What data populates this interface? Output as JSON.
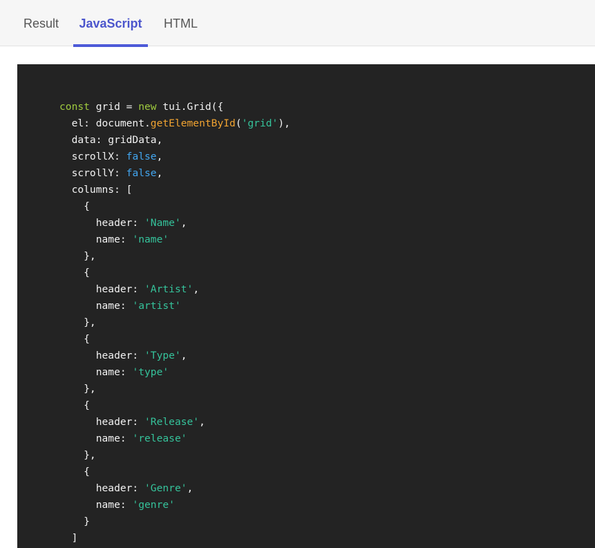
{
  "tabs": [
    {
      "label": "Result",
      "active": false
    },
    {
      "label": "JavaScript",
      "active": true
    },
    {
      "label": "HTML",
      "active": false
    }
  ],
  "colors": {
    "accent": "#4d5ad8",
    "code_background": "#232323",
    "keyword": "#9fca3e",
    "function": "#f0a331",
    "string": "#35c39b",
    "boolean": "#42a6f0"
  },
  "code": {
    "line1": {
      "kw_const": "const",
      "t1": " grid = ",
      "kw_new": "new",
      "t2": " tui.Grid({"
    },
    "line2": {
      "t1": "  el: document.",
      "fn": "getElementById",
      "t2": "(",
      "str": "'grid'",
      "t3": "),"
    },
    "line3": {
      "t1": "  data: gridData,"
    },
    "line4": {
      "t1": "  scrollX: ",
      "bool": "false",
      "t2": ","
    },
    "line5": {
      "t1": "  scrollY: ",
      "bool": "false",
      "t2": ","
    },
    "line6": {
      "t1": "  columns: ["
    },
    "line7": {
      "t1": "    {"
    },
    "line8": {
      "t1": "      header: ",
      "str": "'Name'",
      "t2": ","
    },
    "line9": {
      "t1": "      name: ",
      "str": "'name'"
    },
    "line10": {
      "t1": "    },"
    },
    "line11": {
      "t1": "    {"
    },
    "line12": {
      "t1": "      header: ",
      "str": "'Artist'",
      "t2": ","
    },
    "line13": {
      "t1": "      name: ",
      "str": "'artist'"
    },
    "line14": {
      "t1": "    },"
    },
    "line15": {
      "t1": "    {"
    },
    "line16": {
      "t1": "      header: ",
      "str": "'Type'",
      "t2": ","
    },
    "line17": {
      "t1": "      name: ",
      "str": "'type'"
    },
    "line18": {
      "t1": "    },"
    },
    "line19": {
      "t1": "    {"
    },
    "line20": {
      "t1": "      header: ",
      "str": "'Release'",
      "t2": ","
    },
    "line21": {
      "t1": "      name: ",
      "str": "'release'"
    },
    "line22": {
      "t1": "    },"
    },
    "line23": {
      "t1": "    {"
    },
    "line24": {
      "t1": "      header: ",
      "str": "'Genre'",
      "t2": ","
    },
    "line25": {
      "t1": "      name: ",
      "str": "'genre'"
    },
    "line26": {
      "t1": "    }"
    },
    "line27": {
      "t1": "  ]"
    }
  }
}
